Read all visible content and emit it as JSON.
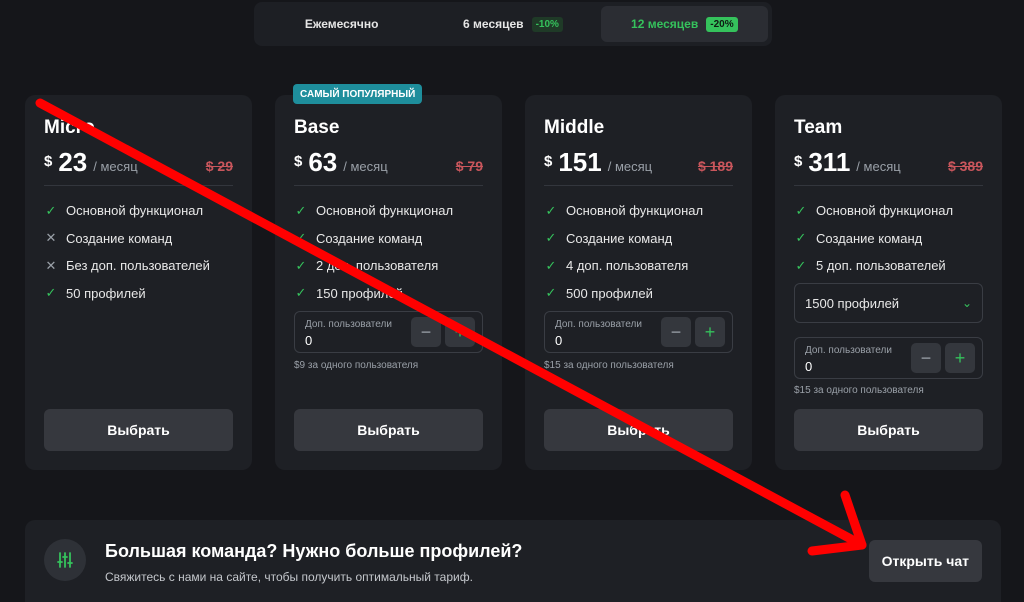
{
  "billing": {
    "options": [
      {
        "label": "Ежемесячно",
        "discount": ""
      },
      {
        "label": "6 месяцев",
        "discount": "-10%"
      },
      {
        "label": "12 месяцев",
        "discount": "-20%"
      }
    ],
    "active_index": 2
  },
  "popular_badge": "САМЫЙ ПОПУЛЯРНЫЙ",
  "plans": [
    {
      "name": "Micro",
      "currency": "$",
      "price": "23",
      "per": "/ месяц",
      "old_price": "$ 29",
      "features": [
        {
          "text": "Основной функционал",
          "included": true
        },
        {
          "text": "Создание команд",
          "included": false
        },
        {
          "text": "Без доп. пользователей",
          "included": false
        },
        {
          "text": "50 профилей",
          "included": true
        }
      ],
      "choose_label": "Выбрать"
    },
    {
      "name": "Base",
      "currency": "$",
      "price": "63",
      "per": "/ месяц",
      "old_price": "$ 79",
      "features": [
        {
          "text": "Основной функционал",
          "included": true
        },
        {
          "text": "Создание команд",
          "included": true
        },
        {
          "text": "2 доп. пользователя",
          "included": true
        },
        {
          "text": "150 профилей",
          "included": true
        }
      ],
      "addon": {
        "label": "Доп. пользователи",
        "value": "0",
        "minus": "−",
        "plus": "+",
        "note": "$9 за одного пользователя"
      },
      "choose_label": "Выбрать"
    },
    {
      "name": "Middle",
      "currency": "$",
      "price": "151",
      "per": "/ месяц",
      "old_price": "$ 189",
      "features": [
        {
          "text": "Основной функционал",
          "included": true
        },
        {
          "text": "Создание команд",
          "included": true
        },
        {
          "text": "4 доп. пользователя",
          "included": true
        },
        {
          "text": "500 профилей",
          "included": true
        }
      ],
      "addon": {
        "label": "Доп. пользователи",
        "value": "0",
        "minus": "−",
        "plus": "+",
        "note": "$15 за одного пользователя"
      },
      "choose_label": "Выбрать"
    },
    {
      "name": "Team",
      "currency": "$",
      "price": "311",
      "per": "/ месяц",
      "old_price": "$ 389",
      "features": [
        {
          "text": "Основной функционал",
          "included": true
        },
        {
          "text": "Создание команд",
          "included": true
        },
        {
          "text": "5 доп. пользователей",
          "included": true
        }
      ],
      "profiles_select": "1500 профилей",
      "addon": {
        "label": "Доп. пользователи",
        "value": "0",
        "minus": "−",
        "plus": "+",
        "note": "$15 за одного пользователя"
      },
      "choose_label": "Выбрать"
    }
  ],
  "banner": {
    "title": "Большая команда? Нужно больше профилей?",
    "subtitle": "Свяжитесь с нами на сайте, чтобы получить оптимальный тариф.",
    "button": "Открыть чат"
  },
  "colors": {
    "accent": "#35c25c",
    "badge": "#1e8e9c",
    "old_price": "#c9565c",
    "annotation": "#ff0000"
  }
}
